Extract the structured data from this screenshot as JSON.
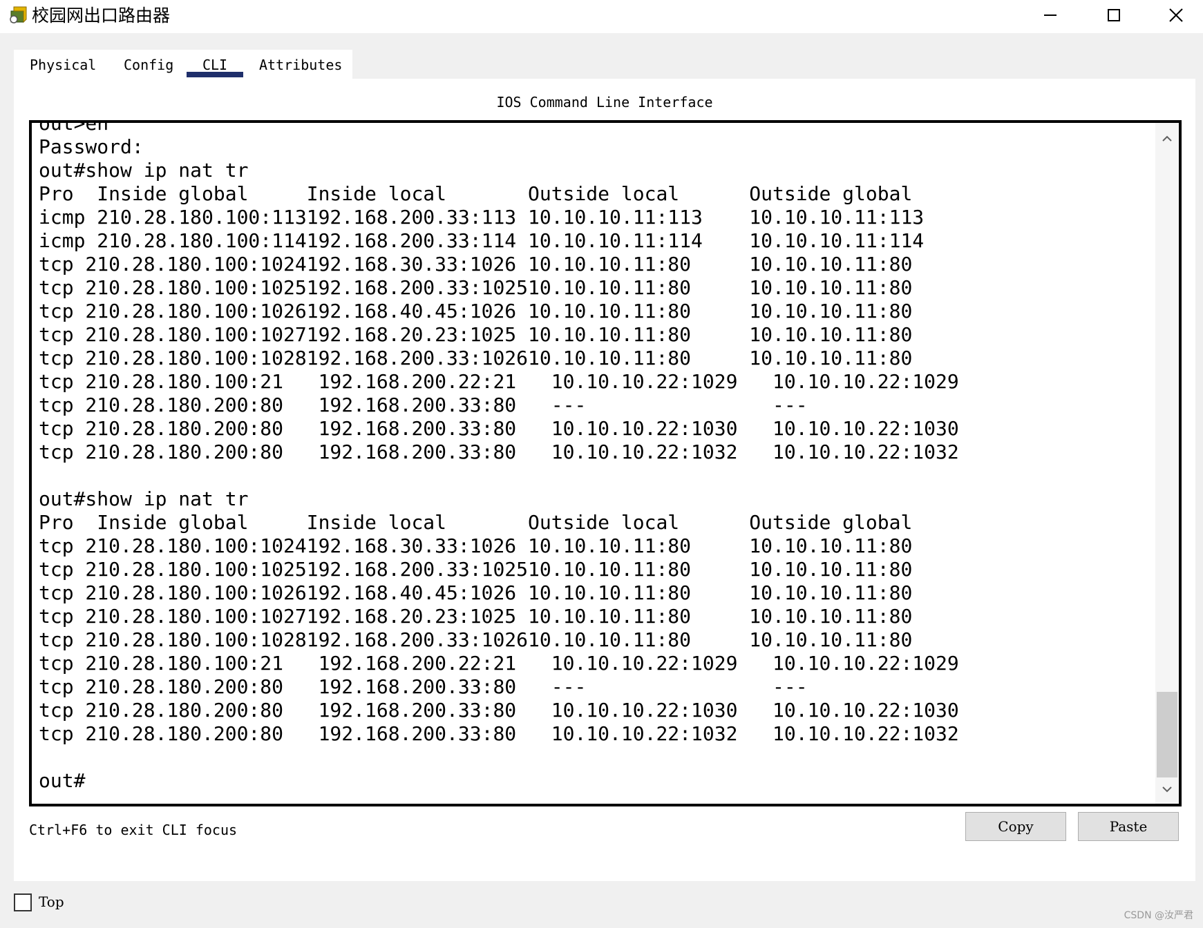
{
  "window": {
    "title": "校园网出口路由器",
    "minimize_symbol": "—",
    "maximize_symbol": "☐",
    "close_symbol": "✕"
  },
  "tabs": [
    {
      "label": "Physical"
    },
    {
      "label": "Config"
    },
    {
      "label": "CLI",
      "active": true
    },
    {
      "label": "Attributes"
    }
  ],
  "cli": {
    "heading": "IOS Command Line Interface",
    "lines": [
      "out>en",
      "Password:",
      "out#show ip nat tr",
      "Pro  Inside global     Inside local       Outside local      Outside global",
      "icmp 210.28.180.100:113192.168.200.33:113 10.10.10.11:113    10.10.10.11:113",
      "icmp 210.28.180.100:114192.168.200.33:114 10.10.10.11:114    10.10.10.11:114",
      "tcp 210.28.180.100:1024192.168.30.33:1026 10.10.10.11:80     10.10.10.11:80",
      "tcp 210.28.180.100:1025192.168.200.33:102510.10.10.11:80     10.10.10.11:80",
      "tcp 210.28.180.100:1026192.168.40.45:1026 10.10.10.11:80     10.10.10.11:80",
      "tcp 210.28.180.100:1027192.168.20.23:1025 10.10.10.11:80     10.10.10.11:80",
      "tcp 210.28.180.100:1028192.168.200.33:102610.10.10.11:80     10.10.10.11:80",
      "tcp 210.28.180.100:21   192.168.200.22:21   10.10.10.22:1029   10.10.10.22:1029",
      "tcp 210.28.180.200:80   192.168.200.33:80   ---                ---",
      "tcp 210.28.180.200:80   192.168.200.33:80   10.10.10.22:1030   10.10.10.22:1030",
      "tcp 210.28.180.200:80   192.168.200.33:80   10.10.10.22:1032   10.10.10.22:1032",
      "",
      "out#show ip nat tr",
      "Pro  Inside global     Inside local       Outside local      Outside global",
      "tcp 210.28.180.100:1024192.168.30.33:1026 10.10.10.11:80     10.10.10.11:80",
      "tcp 210.28.180.100:1025192.168.200.33:102510.10.10.11:80     10.10.10.11:80",
      "tcp 210.28.180.100:1026192.168.40.45:1026 10.10.10.11:80     10.10.10.11:80",
      "tcp 210.28.180.100:1027192.168.20.23:1025 10.10.10.11:80     10.10.10.11:80",
      "tcp 210.28.180.100:1028192.168.200.33:102610.10.10.11:80     10.10.10.11:80",
      "tcp 210.28.180.100:21   192.168.200.22:21   10.10.10.22:1029   10.10.10.22:1029",
      "tcp 210.28.180.200:80   192.168.200.33:80   ---                ---",
      "tcp 210.28.180.200:80   192.168.200.33:80   10.10.10.22:1030   10.10.10.22:1030",
      "tcp 210.28.180.200:80   192.168.200.33:80   10.10.10.22:1032   10.10.10.22:1032",
      "",
      "out#"
    ],
    "scroll_position": 0.92
  },
  "footer": {
    "hint": "Ctrl+F6 to exit CLI focus",
    "copy_label": "Copy",
    "paste_label": "Paste"
  },
  "bottom": {
    "top_label": "Top",
    "top_checked": false,
    "watermark": "CSDN @汝严君"
  },
  "colors": {
    "active_tab_underline": "#1f2f6b",
    "scroll_thumb": "#cdcdcd"
  }
}
